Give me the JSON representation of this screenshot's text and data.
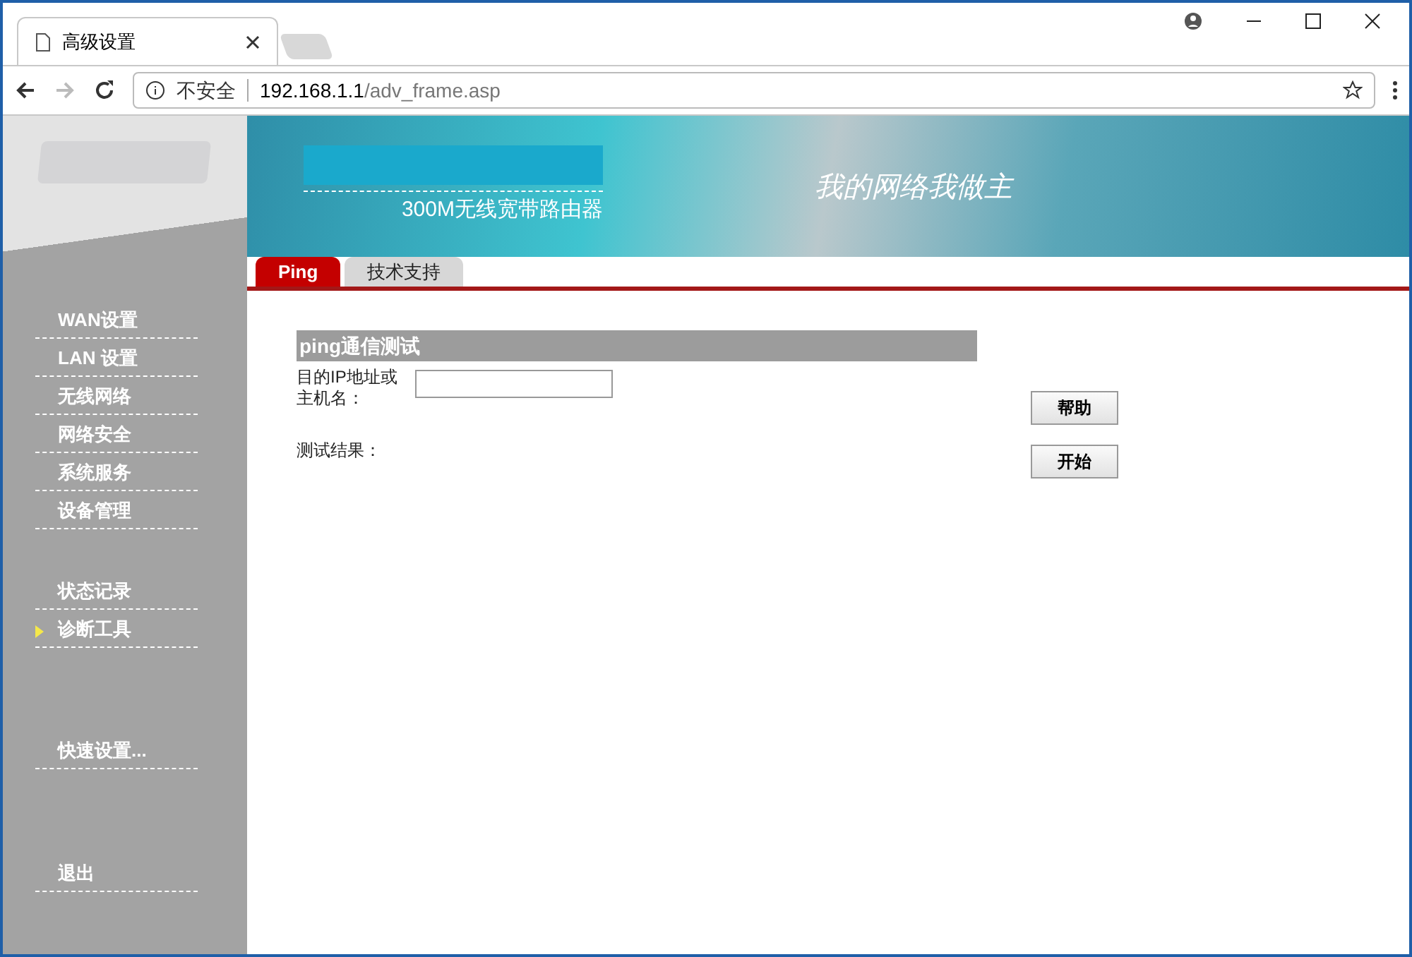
{
  "browser": {
    "tab_title": "高级设置",
    "security": "不安全",
    "url_host": "192.168.1.1",
    "url_path": "/adv_frame.asp"
  },
  "banner": {
    "product": "300M无线宽带路由器",
    "slogan": "我的网络我做主"
  },
  "tabs": [
    {
      "label": "Ping",
      "selected": true
    },
    {
      "label": "技术支持",
      "selected": false
    }
  ],
  "sidebar": {
    "groups": [
      {
        "items": [
          {
            "label": "WAN设置",
            "selected": false
          },
          {
            "label": "LAN 设置",
            "selected": false
          },
          {
            "label": "无线网络",
            "selected": false
          },
          {
            "label": "网络安全",
            "selected": false
          },
          {
            "label": "系统服务",
            "selected": false
          },
          {
            "label": "设备管理",
            "selected": false
          }
        ]
      },
      {
        "items": [
          {
            "label": "状态记录",
            "selected": false
          },
          {
            "label": "诊断工具",
            "selected": true
          }
        ]
      },
      {
        "items": [
          {
            "label": "快速设置...",
            "selected": false
          }
        ]
      },
      {
        "items": [
          {
            "label": "退出",
            "selected": false
          }
        ]
      }
    ]
  },
  "section": {
    "title": "ping通信测试",
    "host_label": "目的IP地址或主机名：",
    "result_label": "测试结果：",
    "help_button": "帮助",
    "start_button": "开始"
  }
}
